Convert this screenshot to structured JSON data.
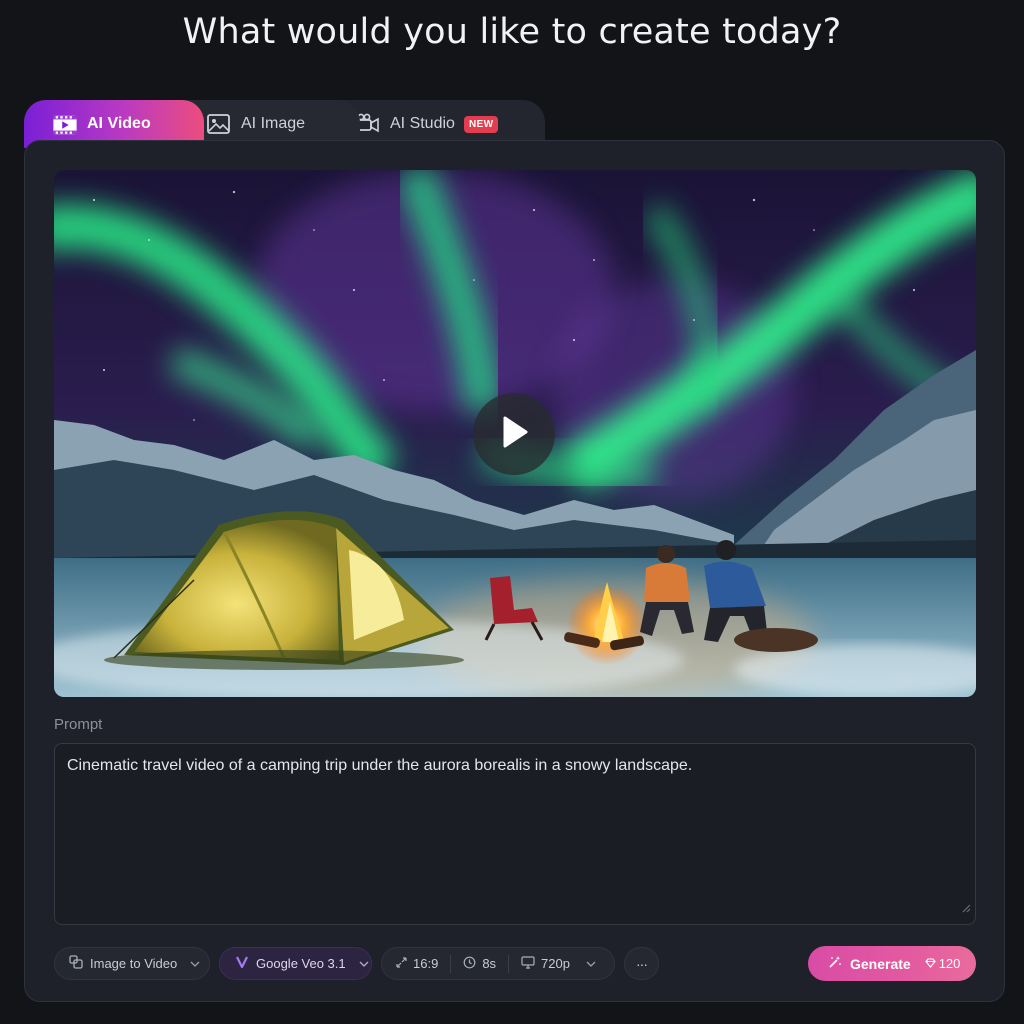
{
  "headline": "What would you like to create today?",
  "tabs": [
    {
      "label": "AI Video",
      "icon": "video-clip-icon",
      "active": true
    },
    {
      "label": "AI Image",
      "icon": "image-icon",
      "active": false
    },
    {
      "label": "AI Studio",
      "icon": "movie-camera-icon",
      "active": false,
      "badge": "NEW"
    }
  ],
  "preview": {
    "description_icon": "play-icon",
    "play_button": "play-icon"
  },
  "prompt": {
    "label": "Prompt",
    "value": "Cinematic travel video of a camping trip under the aurora borealis in a snowy landscape."
  },
  "toolbar": {
    "mode": "Image to Video",
    "model": "Google Veo 3.1",
    "aspect_ratio": "16:9",
    "duration": "8s",
    "resolution": "720p",
    "more": "···"
  },
  "generate": {
    "label": "Generate",
    "cost": "120"
  },
  "colors": {
    "accent_purple": "#7a1fd6",
    "accent_pink": "#e35aa0",
    "badge_red": "#e43d4f",
    "background": "#131418",
    "card": "#1e2129"
  }
}
